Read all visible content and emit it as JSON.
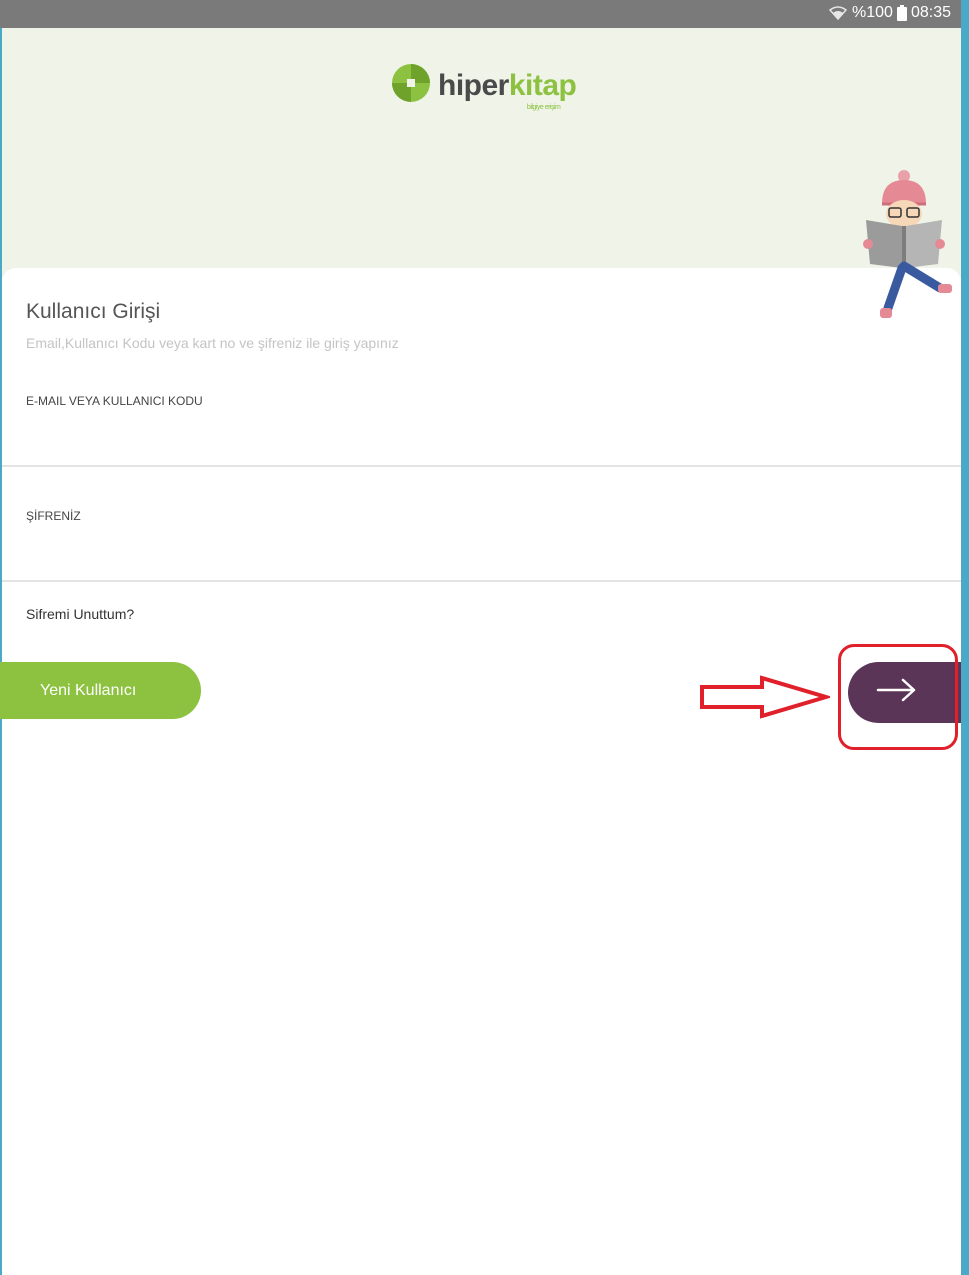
{
  "status_bar": {
    "battery_percent": "%100",
    "time": "08:35"
  },
  "logo": {
    "brand_part1": "hiper",
    "brand_part2": "kitap",
    "tagline": "bilgiye erişim"
  },
  "login": {
    "title": "Kullanıcı Girişi",
    "subtitle": "Email,Kullanıcı Kodu veya kart no ve şifreniz ile giriş yapınız",
    "email_label": "E-MAIL VEYA KULLANICI KODU",
    "email_value": "",
    "password_label": "ŞİFRENİZ",
    "password_value": "",
    "forgot_password": "Sifremi Unuttum?",
    "new_user_button": "Yeni Kullanıcı",
    "submit_icon": "arrow-right-icon"
  },
  "colors": {
    "brand_green": "#8cc23f",
    "brand_purple": "#5a3558",
    "header_bg": "#eff3e8",
    "annotation_red": "#e0202a"
  }
}
